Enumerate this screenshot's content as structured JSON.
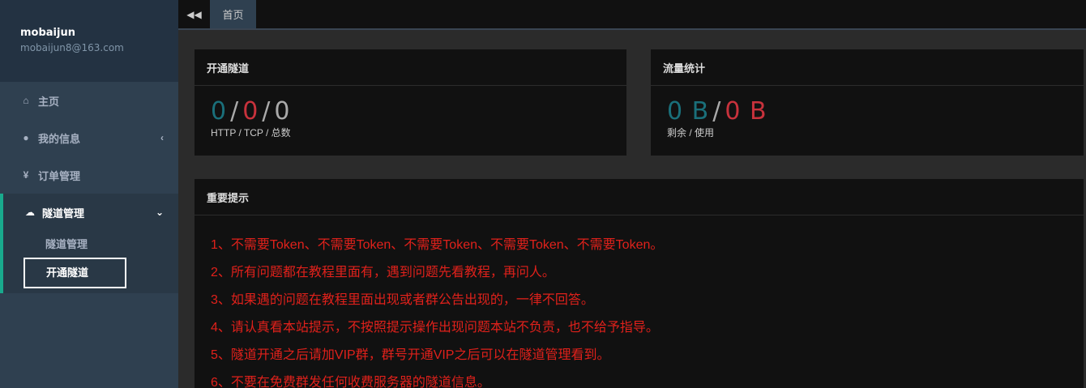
{
  "profile": {
    "name": "mobaijun",
    "email": "mobaijun8@163.com"
  },
  "nav": [
    {
      "icon": "home-icon",
      "glyph": "⌂",
      "label": "主页"
    },
    {
      "icon": "user-icon",
      "glyph": "●",
      "label": "我的信息",
      "arrow": "‹"
    },
    {
      "icon": "yen-icon",
      "glyph": "¥",
      "label": "订单管理"
    },
    {
      "icon": "cloud-icon",
      "glyph": "☁",
      "label": "隧道管理",
      "arrow": "⌄"
    }
  ],
  "subnav": [
    {
      "label": "隧道管理"
    },
    {
      "label": "开通隧道"
    }
  ],
  "topbar": {
    "collapse_glyph": "◀◀",
    "tab_label": "首页"
  },
  "tunnel_panel": {
    "title": "开通隧道",
    "http": "0",
    "tcp": "0",
    "total": "0",
    "sep": "/",
    "caption": "HTTP / TCP / 总数"
  },
  "traffic_panel": {
    "title": "流量统计",
    "remaining": "0 B",
    "used": "0 B",
    "sep": "/",
    "caption": "剩余 / 使用"
  },
  "notice_panel": {
    "title": "重要提示",
    "items": [
      "1、不需要Token、不需要Token、不需要Token、不需要Token、不需要Token。",
      "2、所有问题都在教程里面有，遇到问题先看教程，再问人。",
      "3、如果遇的问题在教程里面出现或者群公告出现的，一律不回答。",
      "4、请认真看本站提示，不按照提示操作出现问题本站不负责，也不给予指导。",
      "5、隧道开通之后请加VIP群，群号开通VIP之后可以在隧道管理看到。",
      "6、不要在免费群发任何收费服务器的隧道信息。"
    ]
  },
  "colors": {
    "accent": "#19aa8d",
    "teal_value": "#1a6f7a",
    "red_value": "#c8323c",
    "notice_text": "#e0211b"
  }
}
